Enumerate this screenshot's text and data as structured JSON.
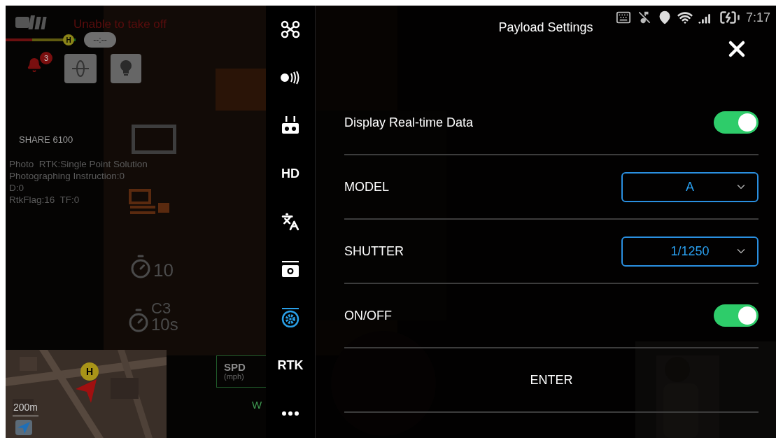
{
  "status_bar": {
    "time": "7:17"
  },
  "hud": {
    "warning": "Unable to take off",
    "home_badge": "H",
    "flight_timer": "--:--",
    "alert_count": "3",
    "camera_name": "SHARE 6100",
    "info_lines": [
      "Photo  RTK:Single Point Solution",
      "Photographing Instruction:0",
      "D:0",
      "RtkFlag:16  TF:0"
    ],
    "self_timer": "10",
    "interval_mode": "C3",
    "interval_time": "10s",
    "map_home_marker": "H",
    "map_scale": "200m",
    "speed_label": "SPD",
    "speed_unit": "(mph)",
    "wind_label": "W"
  },
  "sidebar": {
    "items": [
      {
        "kind": "icon",
        "selected": false
      },
      {
        "kind": "icon",
        "selected": false
      },
      {
        "kind": "icon",
        "selected": false
      },
      {
        "kind": "text",
        "label": "HD",
        "selected": false
      },
      {
        "kind": "icon",
        "selected": false
      },
      {
        "kind": "icon",
        "selected": false
      },
      {
        "kind": "icon",
        "selected": true
      },
      {
        "kind": "text",
        "label": "RTK",
        "selected": false
      },
      {
        "kind": "icon",
        "selected": false
      }
    ]
  },
  "panel": {
    "title": "Payload Settings",
    "rows": [
      {
        "kind": "toggle",
        "label": "Display Real-time Data",
        "on": true
      },
      {
        "kind": "select",
        "label": "MODEL",
        "value": "A"
      },
      {
        "kind": "select",
        "label": "SHUTTER",
        "value": "1/1250"
      },
      {
        "kind": "toggle",
        "label": "ON/OFF",
        "on": true
      },
      {
        "kind": "button",
        "label": "ENTER"
      }
    ]
  }
}
